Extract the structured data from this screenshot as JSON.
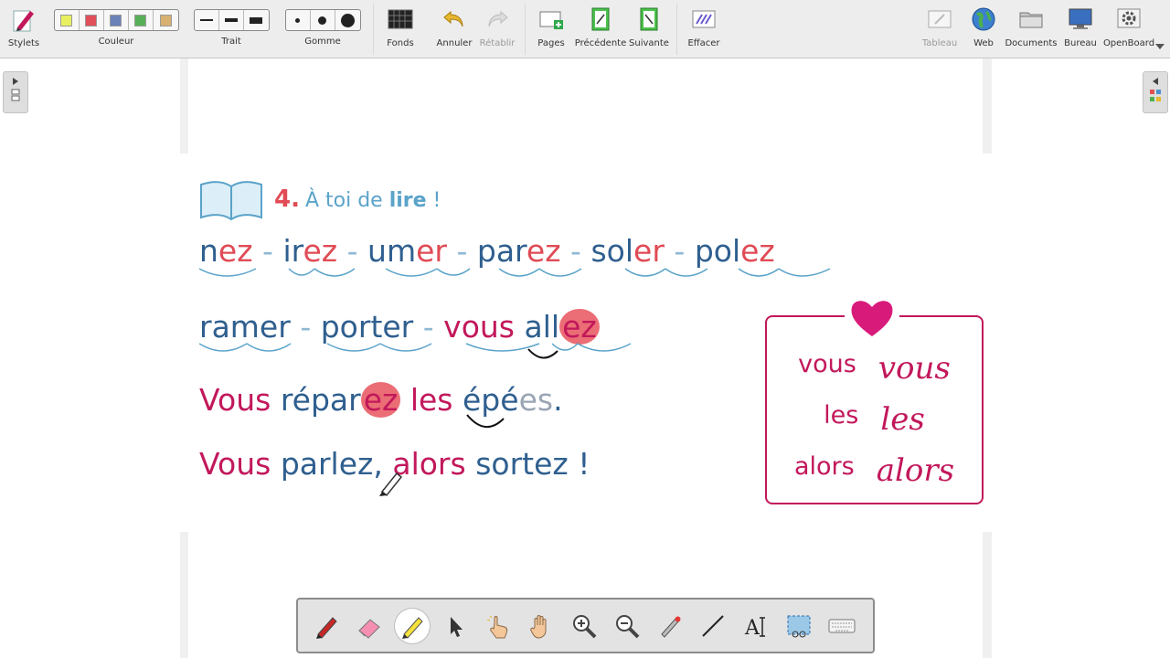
{
  "toolbar": {
    "stylets": "Stylets",
    "couleur": "Couleur",
    "trait": "Trait",
    "gomme": "Gomme",
    "fonds": "Fonds",
    "annuler": "Annuler",
    "retablir": "Rétablir",
    "pages": "Pages",
    "precedente": "Précédente",
    "suivante": "Suivante",
    "effacer": "Effacer",
    "tableau": "Tableau",
    "web": "Web",
    "documents": "Documents",
    "bureau": "Bureau",
    "openboard": "OpenBoard",
    "colors": [
      "#e8f060",
      "#e0505a",
      "#6a82b8",
      "#58b058",
      "#d8b070"
    ]
  },
  "lesson": {
    "number": "4.",
    "title_pre": "À toi de ",
    "title_bold": "lire",
    "title_post": " !",
    "line1": {
      "w1a": "n",
      "w1b": "ez",
      "w2a": "ir",
      "w2b": "ez",
      "w3a": "um",
      "w3b": "er",
      "w4a": "par",
      "w4b": "ez",
      "w5a": "sol",
      "w5b": "er",
      "w6a": "pol",
      "w6b": "ez",
      "sep": "-"
    },
    "line2": {
      "w1": "ramer",
      "w2": "porter",
      "w3": "vous",
      "w4a": "all",
      "w4b": "ez",
      "sep": "-"
    },
    "line3": {
      "w1": "Vous",
      "w2a": "répar",
      "w2b": "ez",
      "w3": "les",
      "w4a": "épé",
      "w4b": "es",
      "end": "."
    },
    "line4": {
      "w1": "Vous",
      "w2": "parlez,",
      "w3": "alors",
      "w4": "sortez !"
    }
  },
  "words_box": {
    "rows": [
      {
        "print": "vous",
        "cursive": "vous"
      },
      {
        "print": "les",
        "cursive": "les"
      },
      {
        "print": "alors",
        "cursive": "alors"
      }
    ]
  }
}
